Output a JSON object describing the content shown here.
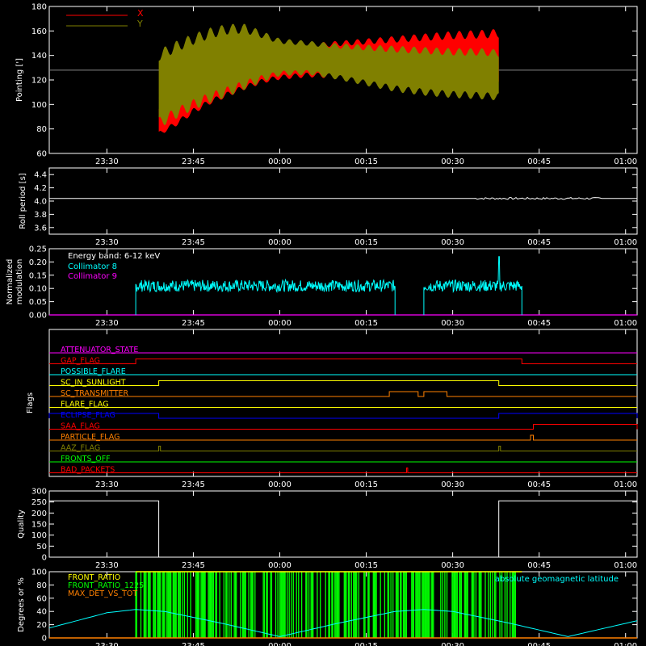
{
  "time_ticks": [
    "23:30",
    "23:45",
    "00:00",
    "00:15",
    "00:30",
    "00:45",
    "01:00"
  ],
  "chart_data": [
    {
      "id": "pointing",
      "type": "line",
      "ylabel": "Pointing [']",
      "ylim": [
        60,
        180
      ],
      "yticks": [
        60,
        80,
        100,
        120,
        140,
        160,
        180
      ],
      "reference_line": 128,
      "legend": [
        {
          "name": "X",
          "color": "#ff0000"
        },
        {
          "name": "Y",
          "color": "#808000"
        }
      ],
      "series": [
        {
          "name": "X",
          "color": "#ff0000",
          "active_from": "23:39",
          "active_to": "00:38",
          "envelope_t": [
            "23:39",
            "23:42",
            "23:45",
            "23:48",
            "23:51",
            "23:54",
            "23:57",
            "00:00",
            "00:05",
            "00:10",
            "00:15",
            "00:20",
            "00:25",
            "00:30",
            "00:35",
            "00:38"
          ],
          "envelope_max": [
            100,
            112,
            125,
            132,
            137,
            141,
            144,
            148,
            150,
            152,
            154,
            156,
            158,
            160,
            161,
            162
          ],
          "envelope_min": [
            74,
            82,
            92,
            100,
            106,
            112,
            117,
            120,
            122,
            121,
            120,
            118,
            116,
            114,
            112,
            111
          ]
        },
        {
          "name": "Y",
          "color": "#808000",
          "active_from": "23:39",
          "active_to": "00:38",
          "envelope_t": [
            "23:39",
            "23:42",
            "23:45",
            "23:48",
            "23:51",
            "23:54",
            "23:57",
            "00:00",
            "00:05",
            "00:10",
            "00:15",
            "00:20",
            "00:25",
            "00:30",
            "00:35",
            "00:38"
          ],
          "envelope_max": [
            145,
            152,
            158,
            163,
            166,
            166,
            160,
            154,
            152,
            150,
            149,
            148,
            147,
            146,
            146,
            145
          ],
          "envelope_min": [
            80,
            88,
            95,
            101,
            106,
            112,
            118,
            123,
            124,
            120,
            115,
            110,
            107,
            105,
            104,
            103
          ]
        }
      ]
    },
    {
      "id": "roll",
      "type": "line",
      "ylabel": "Roll period [s]",
      "ylim": [
        3.5,
        4.5
      ],
      "yticks": [
        3.6,
        3.8,
        4.0,
        4.2,
        4.4
      ],
      "series": [
        {
          "name": "",
          "color": "#ffffff",
          "value": 4.04
        }
      ]
    },
    {
      "id": "modulation",
      "type": "line",
      "ylabel": "Normalized modulation",
      "ylim": [
        0,
        0.25
      ],
      "yticks": [
        0.0,
        0.05,
        0.1,
        0.15,
        0.2,
        0.25
      ],
      "annotation": "Energy band: 6-12 keV",
      "legend": [
        {
          "name": "Collimator 8",
          "color": "#00ffff"
        },
        {
          "name": "Collimator 9",
          "color": "#ff00ff"
        }
      ],
      "series": [
        {
          "name": "Collimator 8",
          "color": "#00ffff",
          "segments": [
            [
              "23:35",
              "00:20"
            ],
            [
              "00:25",
              "00:42"
            ]
          ],
          "mean": 0.11,
          "spike": {
            "t": "00:38",
            "value": 0.22
          }
        },
        {
          "name": "Collimator 9",
          "color": "#ff00ff",
          "value": 0.0
        }
      ]
    },
    {
      "id": "flags",
      "type": "step",
      "ylabel": "Flags",
      "flags": [
        {
          "name": "ATTENUATOR_STATE",
          "color": "#ff00ff",
          "steps": []
        },
        {
          "name": "GAP_FLAG",
          "color": "#ff0000",
          "steps": [
            [
              "23:35",
              "00:42"
            ]
          ]
        },
        {
          "name": "POSSIBLE_FLARE",
          "color": "#00ffff",
          "steps": []
        },
        {
          "name": "SC_IN_SUNLIGHT",
          "color": "#ffff00",
          "steps": [
            [
              "23:39",
              "00:38"
            ]
          ]
        },
        {
          "name": "SC_TRANSMITTER",
          "color": "#ff8000",
          "steps": [
            [
              "00:19",
              "00:24"
            ],
            [
              "00:25",
              "00:29"
            ]
          ]
        },
        {
          "name": "FLARE_FLAG",
          "color": "#ffff00",
          "steps": []
        },
        {
          "name": "ECLIPSE_FLAG",
          "color": "#0000ff",
          "steps": [
            [
              "23:20",
              "23:39"
            ],
            [
              "00:38",
              "01:02"
            ]
          ]
        },
        {
          "name": "SAA_FLAG",
          "color": "#ff0000",
          "steps": [
            [
              "00:44",
              "01:02"
            ]
          ]
        },
        {
          "name": "PARTICLE_FLAG",
          "color": "#ff8000",
          "steps": [
            [
              "00:43.5",
              "00:44"
            ]
          ]
        },
        {
          "name": "AAZ_FLAG",
          "color": "#808000",
          "steps": [
            [
              "23:39",
              "23:39.3"
            ],
            [
              "00:38",
              "00:38.3"
            ]
          ]
        },
        {
          "name": "FRONTS_OFF",
          "color": "#00ff00",
          "steps": []
        },
        {
          "name": "BAD_PACKETS",
          "color": "#ff0000",
          "steps": [
            [
              "00:22",
              "00:22.2"
            ]
          ]
        }
      ]
    },
    {
      "id": "quality",
      "type": "line",
      "ylabel": "Quality",
      "ylim": [
        0,
        300
      ],
      "yticks": [
        0,
        50,
        100,
        150,
        200,
        250,
        300
      ],
      "series": [
        {
          "name": "",
          "color": "#ffffff",
          "points": [
            [
              "23:20",
              255
            ],
            [
              "23:39",
              255
            ],
            [
              "23:39",
              0
            ],
            [
              "00:38",
              0
            ],
            [
              "00:38",
              255
            ],
            [
              "01:02",
              255
            ]
          ]
        }
      ]
    },
    {
      "id": "ratios",
      "type": "line",
      "ylabel": "Degrees or %",
      "ylim": [
        0,
        100
      ],
      "yticks": [
        0,
        20,
        40,
        60,
        80,
        100
      ],
      "legend": [
        {
          "name": "FRONT_RATIO",
          "color": "#ffff00"
        },
        {
          "name": "FRONT_RATIO_1225",
          "color": "#00ff00"
        },
        {
          "name": "MAX_DET_VS_TOT",
          "color": "#ff8000"
        }
      ],
      "right_legend": {
        "name": "absolute geomagnetic latitude",
        "color": "#00ffff"
      },
      "series": [
        {
          "name": "FRONT_RATIO_1225",
          "color": "#00ff00",
          "segment": [
            "23:35",
            "00:42"
          ]
        },
        {
          "name": "absolute geomagnetic latitude",
          "color": "#00ffff",
          "points": [
            [
              "23:20",
              15
            ],
            [
              "23:30",
              38
            ],
            [
              "23:35",
              43
            ],
            [
              "23:40",
              40
            ],
            [
              "23:50",
              22
            ],
            [
              "00:00",
              2
            ],
            [
              "00:10",
              22
            ],
            [
              "00:20",
              40
            ],
            [
              "00:25",
              43
            ],
            [
              "00:30",
              40
            ],
            [
              "00:40",
              22
            ],
            [
              "00:50",
              2
            ],
            [
              "01:00",
              22
            ],
            [
              "01:02",
              26
            ]
          ]
        }
      ]
    }
  ]
}
